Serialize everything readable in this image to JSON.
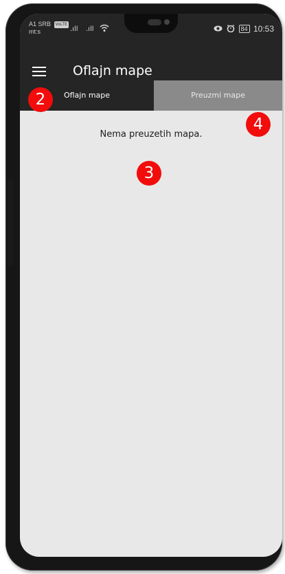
{
  "statusbar": {
    "carrier": "A1 SRB",
    "carrier_tag": "VoLTE",
    "operator2": "mt:s",
    "signal1": ".ıll",
    "signal2": ".ıll",
    "wifi_icon": "wifi-icon",
    "eye_icon": "eye-icon",
    "alarm_icon": "alarm-icon",
    "battery": "84",
    "time": "10:53"
  },
  "toolbar": {
    "menu_icon": "hamburger-menu-icon",
    "title": "Oflajn mape"
  },
  "tabs": [
    {
      "label": "Oflajn mape",
      "active": true
    },
    {
      "label": "Preuzmi mape",
      "active": false
    }
  ],
  "content": {
    "empty_message": "Nema preuzetih mapa."
  },
  "markers": [
    {
      "number": "2"
    },
    {
      "number": "3"
    },
    {
      "number": "4"
    }
  ],
  "colors": {
    "appbar": "#252525",
    "inactive_tab": "#8a8a8a",
    "background": "#e8e8e8",
    "marker": "#f20c0c"
  }
}
